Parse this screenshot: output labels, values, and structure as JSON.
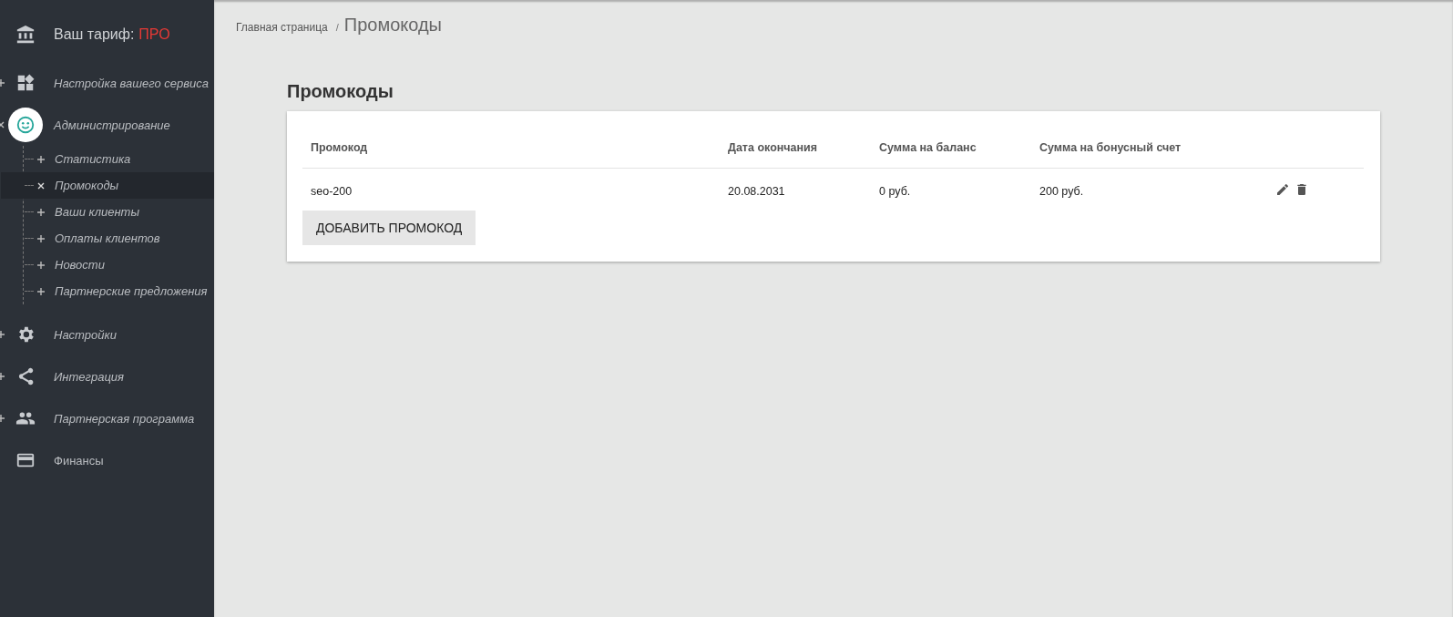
{
  "sidebar": {
    "plan": {
      "label": "Ваш тариф:",
      "value": "ПРО"
    },
    "items": [
      {
        "kind": "group",
        "label": "Настройка вашего сервиса",
        "expanded": false
      },
      {
        "kind": "group",
        "label": "Администрирование",
        "expanded": true,
        "children": [
          {
            "label": "Статистика",
            "selected": false
          },
          {
            "label": "Промокоды",
            "selected": true
          },
          {
            "label": "Ваши клиенты",
            "selected": false
          },
          {
            "label": "Оплаты клиентов",
            "selected": false
          },
          {
            "label": "Новости",
            "selected": false
          },
          {
            "label": "Партнерские предложения",
            "selected": false
          }
        ]
      },
      {
        "kind": "group",
        "label": "Настройки",
        "expanded": false
      },
      {
        "kind": "group",
        "label": "Интеграция",
        "expanded": false
      },
      {
        "kind": "group",
        "label": "Партнерская программа",
        "expanded": false
      },
      {
        "kind": "link",
        "label": "Финансы",
        "expanded": false
      }
    ]
  },
  "breadcrumb": {
    "home": "Главная страница",
    "separator": "/",
    "current": "Промокоды"
  },
  "page_title": "Промокоды",
  "table": {
    "columns": [
      "Промокод",
      "Дата окончания",
      "Сумма на баланс",
      "Сумма на бонусный счет"
    ],
    "rows": [
      [
        "seo-200",
        "20.08.2031",
        "0 руб.",
        "200 руб."
      ]
    ]
  },
  "add_button": "ДОБАВИТЬ ПРОМОКОД"
}
